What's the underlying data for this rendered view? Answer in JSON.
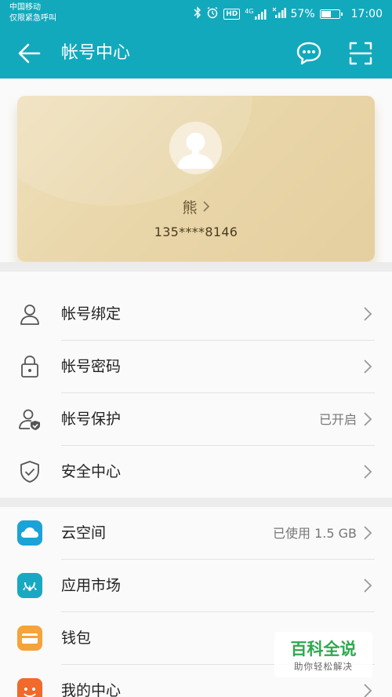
{
  "status_bar": {
    "carrier": "中国移动",
    "emergency": "仅限紧急呼叫",
    "hd": "HD",
    "network": "4G",
    "battery_percent": "57%",
    "battery_level": 57,
    "time": "17:00"
  },
  "app_bar": {
    "title": "帐号中心",
    "icons": [
      "back-arrow-icon",
      "chat-icon",
      "scan-icon"
    ]
  },
  "profile": {
    "name": "熊",
    "phone": "135****8146"
  },
  "security_section": [
    {
      "label": "帐号绑定",
      "value": "",
      "icon": "person-icon"
    },
    {
      "label": "帐号密码",
      "value": "",
      "icon": "lock-icon"
    },
    {
      "label": "帐号保护",
      "value": "已开启",
      "icon": "person-shield-icon"
    },
    {
      "label": "安全中心",
      "value": "",
      "icon": "shield-check-icon"
    }
  ],
  "services_section": [
    {
      "label": "云空间",
      "value": "已使用 1.5 GB",
      "icon": "cloud-icon",
      "color": "#1aa3d6"
    },
    {
      "label": "应用市场",
      "value": "",
      "icon": "huawei-appgallery-icon",
      "color": "#19a8c2"
    },
    {
      "label": "钱包",
      "value": "",
      "icon": "wallet-icon",
      "color": "#f5a33a"
    },
    {
      "label": "我的中心",
      "value": "",
      "icon": "my-center-icon",
      "color": "#f06a2b"
    }
  ],
  "watermark": {
    "title": "百科全说",
    "subtitle": "助你轻松解决"
  },
  "colors": {
    "accent": "#12a9bd",
    "card_gold": "#e9d6a9"
  }
}
